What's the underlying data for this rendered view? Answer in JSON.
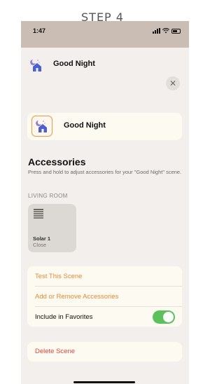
{
  "step_label": "STEP 4",
  "status_bar": {
    "time": "1:47",
    "icons": [
      "signal-icon",
      "wifi-icon",
      "battery-icon"
    ]
  },
  "sheet": {
    "title": "Good Night",
    "close_icon": "close-icon",
    "scene_card": {
      "title": "Good Night",
      "icon": "night-home-icon"
    }
  },
  "accessories": {
    "title": "Accessories",
    "description": "Press and hold to adjust accessories for your \"Good Night\" scene.",
    "room_label": "LIVING ROOM",
    "items": [
      {
        "name": "Solar 1",
        "state": "Close",
        "icon": "blinds-icon"
      }
    ]
  },
  "actions": {
    "test_scene": "Test This Scene",
    "add_remove": "Add or Remove Accessories",
    "favorites_label": "Include in Favorites",
    "favorites_on": true
  },
  "delete_scene": "Delete Scene",
  "colors": {
    "accent_orange": "#e48a32",
    "destructive_red": "#e0443c",
    "toggle_green": "#5cc15a",
    "status_bar_bg": "#c9bdb4",
    "sheet_bg": "#f2efec",
    "card_bg": "#fdfaf2"
  }
}
